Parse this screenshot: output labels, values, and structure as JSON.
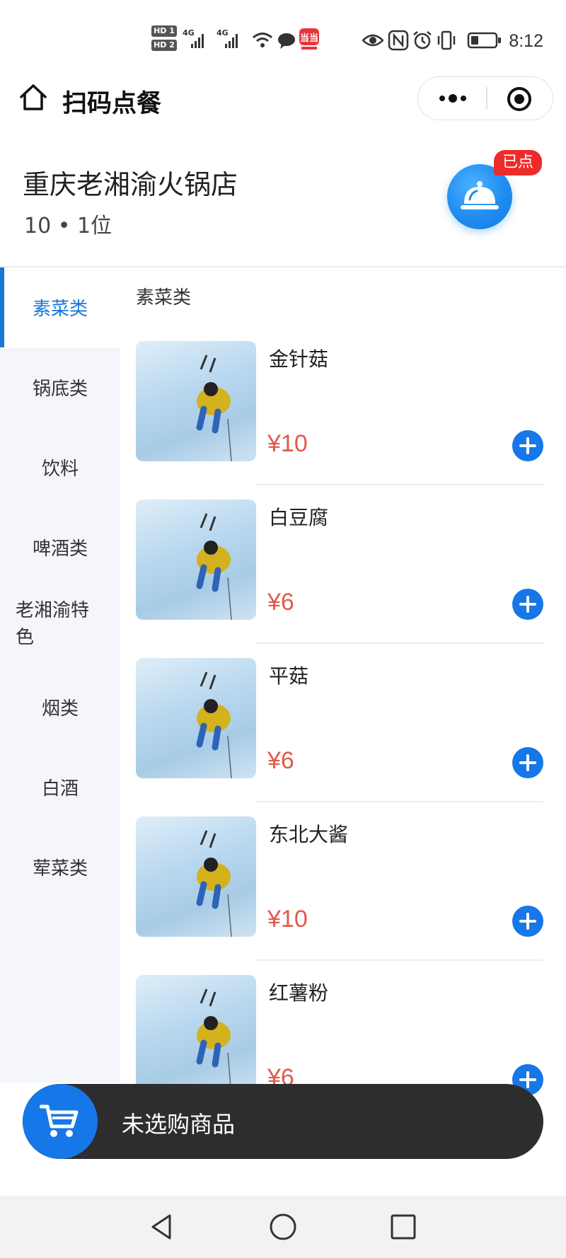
{
  "status_bar": {
    "hd1": "HD 1",
    "hd2": "HD 2",
    "signal1_label": "4G",
    "signal2_label": "4G",
    "time": "8:12",
    "icons": [
      "wifi-icon",
      "chat-bubble-icon",
      "app-badge-icon",
      "eye-icon",
      "nfc-icon",
      "alarm-icon",
      "vibrate-icon",
      "battery-icon"
    ]
  },
  "nav": {
    "title": "扫码点餐",
    "home_icon": "home-icon",
    "more_icon": "more-icon",
    "close_icon": "target-icon"
  },
  "shop": {
    "name": "重庆老湘渝火锅店",
    "table_info": "10 • 1位",
    "ordered_badge": "已点",
    "ordered_icon": "dish-cover-icon"
  },
  "sidebar": {
    "items": [
      {
        "label": "素菜类",
        "active": true
      },
      {
        "label": "锅底类",
        "active": false
      },
      {
        "label": "饮料",
        "active": false
      },
      {
        "label": "啤酒类",
        "active": false
      },
      {
        "label": "老湘渝特色",
        "active": false
      },
      {
        "label": "烟类",
        "active": false
      },
      {
        "label": "白酒",
        "active": false
      },
      {
        "label": "荤菜类",
        "active": false
      }
    ]
  },
  "section": {
    "title": "素菜类"
  },
  "products": [
    {
      "name": "金针菇",
      "price": "¥10"
    },
    {
      "name": "白豆腐",
      "price": "¥6"
    },
    {
      "name": "平菇",
      "price": "¥6"
    },
    {
      "name": "东北大酱",
      "price": "¥10"
    },
    {
      "name": "红薯粉",
      "price": "¥6"
    }
  ],
  "cart": {
    "text": "未选购商品",
    "icon": "cart-icon"
  },
  "android_nav": {
    "icons": [
      "back-icon",
      "home-circle-icon",
      "recents-icon"
    ]
  },
  "colors": {
    "accent": "#1677e8",
    "price": "#e05a4a",
    "badge": "#ee2b2b",
    "cart_bar": "#2d2d2f"
  }
}
